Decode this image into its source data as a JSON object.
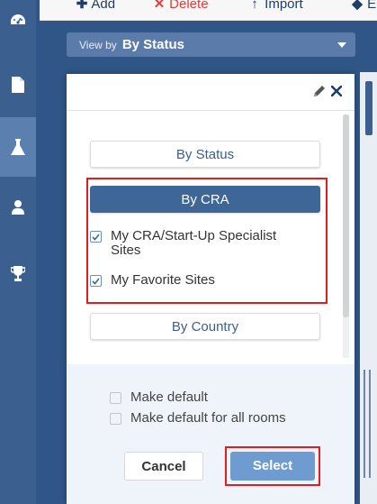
{
  "toolbar": {
    "add_label": "Add",
    "delete_label": "Delete",
    "import_label": "Import",
    "more_label": "E",
    "colors": {
      "add": "#1f3d66",
      "delete": "#e43b3b",
      "import": "#1f3d66"
    }
  },
  "view_by": {
    "prefix": "View by",
    "value": "By Status"
  },
  "rail": {
    "items": [
      {
        "icon": "dashboard-icon",
        "active": false
      },
      {
        "icon": "document-icon",
        "active": false
      },
      {
        "icon": "flask-icon",
        "active": true
      },
      {
        "icon": "user-icon",
        "active": false
      },
      {
        "icon": "trophy-icon",
        "active": false
      }
    ]
  },
  "dialog": {
    "header_icons": [
      "pencil-icon",
      "close-icon"
    ],
    "options": {
      "by_status": "By Status",
      "by_cra": "By CRA",
      "by_country": "By Country"
    },
    "cra_checks": [
      {
        "label": "My CRA/Start-Up Specialist Sites",
        "checked": true
      },
      {
        "label": "My Favorite Sites",
        "checked": true
      }
    ],
    "footer": {
      "make_default": "Make default",
      "make_default_all": "Make default for all rooms",
      "make_default_checked": false,
      "make_default_all_checked": false,
      "cancel_label": "Cancel",
      "select_label": "Select"
    }
  },
  "colors": {
    "nav_bg": "#3b5f8f",
    "primary": "#3e6697",
    "select": "#6e9bd0",
    "highlight": "#e41c1c"
  }
}
